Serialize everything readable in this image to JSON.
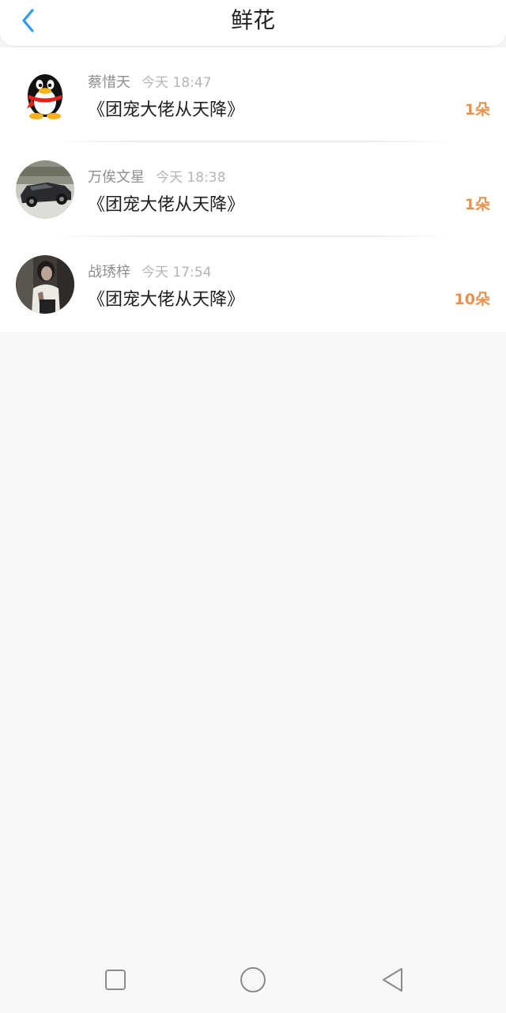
{
  "header": {
    "title": "鲜花",
    "back_icon": "chevron-left-icon",
    "accent_color": "#2d9de8"
  },
  "items": [
    {
      "name": "蔡惜天",
      "time": "今天 18:47",
      "book": "《团宠大佬从天降》",
      "count": "1朵",
      "avatar": "qq-penguin-icon"
    },
    {
      "name": "万俟文星",
      "time": "今天 18:38",
      "book": "《团宠大佬从天降》",
      "count": "1朵",
      "avatar": "car-photo"
    },
    {
      "name": "战琇梓",
      "time": "今天 17:54",
      "book": "《团宠大佬从天降》",
      "count": "10朵",
      "avatar": "person-photo"
    }
  ],
  "count_color": "#e8914a",
  "navbar": {
    "recent_icon": "square-icon",
    "home_icon": "circle-icon",
    "back_icon": "triangle-back-icon"
  }
}
